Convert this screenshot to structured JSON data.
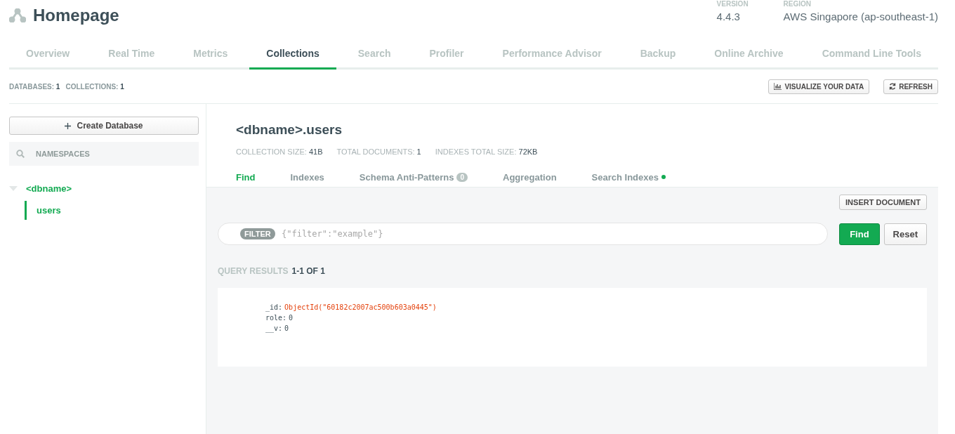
{
  "header": {
    "title": "Homepage",
    "version_label": "VERSION",
    "version": "4.4.3",
    "region_label": "REGION",
    "region": "AWS Singapore (ap-southeast-1)"
  },
  "tabs": [
    {
      "label": "Overview",
      "selected": false
    },
    {
      "label": "Real Time",
      "selected": false
    },
    {
      "label": "Metrics",
      "selected": false
    },
    {
      "label": "Collections",
      "selected": true
    },
    {
      "label": "Search",
      "selected": false
    },
    {
      "label": "Profiler",
      "selected": false
    },
    {
      "label": "Performance Advisor",
      "selected": false
    },
    {
      "label": "Backup",
      "selected": false
    },
    {
      "label": "Online Archive",
      "selected": false
    },
    {
      "label": "Command Line Tools",
      "selected": false
    }
  ],
  "summary": [
    {
      "label": "DATABASES:",
      "value": "1"
    },
    {
      "label": "COLLECTIONS:",
      "value": "1"
    }
  ],
  "toolbar_buttons": [
    {
      "label": "VISUALIZE YOUR DATA",
      "kind": "chart"
    },
    {
      "label": "REFRESH",
      "kind": "refresh"
    }
  ],
  "sidebar": {
    "create_button": "Create Database",
    "search": {
      "placeholder": "NAMESPACES"
    },
    "tree": [
      {
        "label": "<dbname>",
        "expanded": true,
        "children": [
          {
            "label": "users",
            "selected": true
          }
        ]
      }
    ]
  },
  "collection": {
    "title": "<dbname>.users",
    "stats": [
      {
        "label": "COLLECTION SIZE:",
        "value": "41B"
      },
      {
        "label": "TOTAL DOCUMENTS:",
        "value": "1"
      },
      {
        "label": "INDEXES TOTAL SIZE:",
        "value": "72KB"
      }
    ],
    "tabs": [
      {
        "label": "Find",
        "selected": true,
        "dot": false
      },
      {
        "label": "Indexes",
        "selected": false,
        "dot": false
      },
      {
        "label": "Schema Anti-Patterns",
        "selected": false,
        "badge": "0",
        "dot": false
      },
      {
        "label": "Aggregation",
        "selected": false,
        "dot": false
      },
      {
        "label": "Search Indexes",
        "selected": false,
        "dot": true
      }
    ],
    "insert_button": "INSERT DOCUMENT",
    "filter": {
      "badge": "FILTER",
      "placeholder": "{\"filter\":\"example\"}"
    },
    "find_button": "Find",
    "reset_button": "Reset",
    "results": {
      "label": "QUERY RESULTS",
      "range": "1-1 OF 1"
    },
    "documents": [
      {
        "fields": [
          {
            "key": "_id:",
            "value": "ObjectId(\"60182c2007ac500b603a0445\")",
            "kind": "objectid"
          },
          {
            "key": "role:",
            "value": "0",
            "kind": "number"
          },
          {
            "key": "__v:",
            "value": "0",
            "kind": "number"
          }
        ]
      }
    ]
  }
}
